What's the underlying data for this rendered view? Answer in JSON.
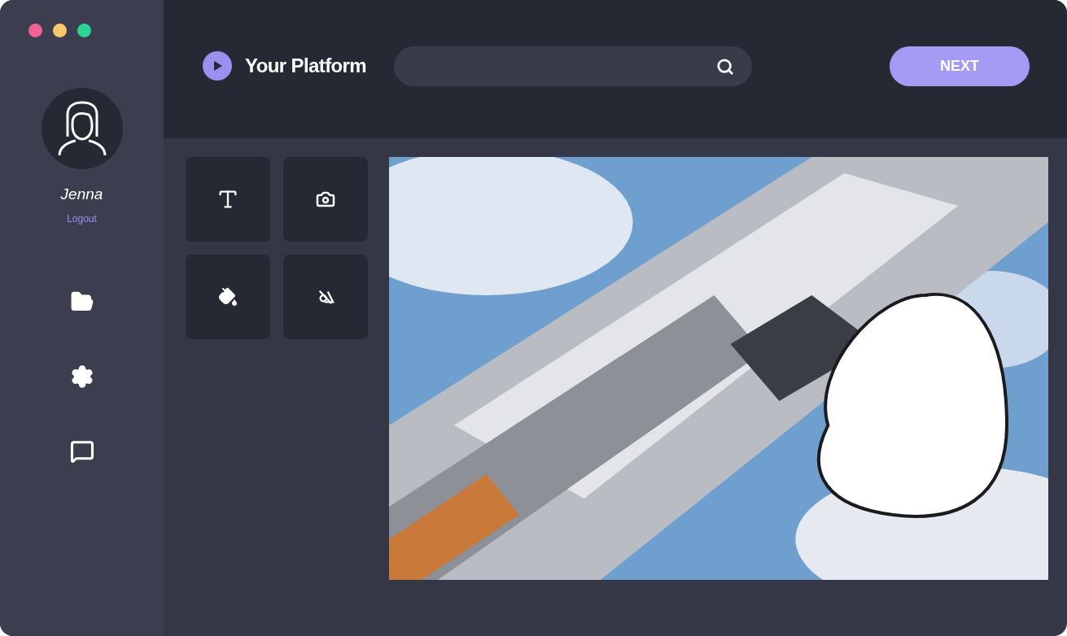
{
  "window": {
    "controls": [
      {
        "color": "#f06292"
      },
      {
        "color": "#f9c86b"
      },
      {
        "color": "#2ed297"
      }
    ]
  },
  "user": {
    "name": "Jenna",
    "logout": "Logout"
  },
  "header": {
    "title": "Your Platform",
    "next_button": "NEXT"
  }
}
